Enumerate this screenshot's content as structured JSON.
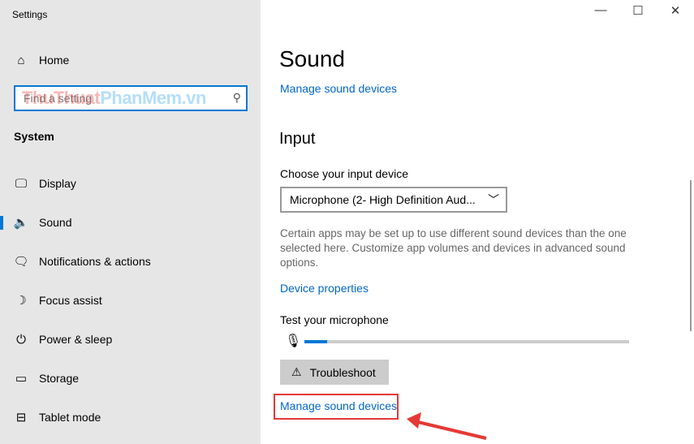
{
  "window": {
    "title": "Settings",
    "minimize": "—",
    "maximize": "☐",
    "close": "✕"
  },
  "sidebar": {
    "home": "Home",
    "search_placeholder": "Find a setting",
    "section": "System",
    "items": [
      {
        "label": "Display",
        "icon": "🖵"
      },
      {
        "label": "Sound",
        "icon": "🔈"
      },
      {
        "label": "Notifications & actions",
        "icon": "🗨"
      },
      {
        "label": "Focus assist",
        "icon": "☽"
      },
      {
        "label": "Power & sleep",
        "icon": "⏻"
      },
      {
        "label": "Storage",
        "icon": "▭"
      },
      {
        "label": "Tablet mode",
        "icon": "⊟"
      }
    ]
  },
  "watermark": {
    "part1": "ThuThuat",
    "part2": "PhanMem",
    "part3": ".vn"
  },
  "main": {
    "title": "Sound",
    "manage_top": "Manage sound devices",
    "input_heading": "Input",
    "choose_label": "Choose your input device",
    "device_value": "Microphone (2- High Definition Aud...",
    "description": "Certain apps may be set up to use different sound devices than the one selected here. Customize app volumes and devices in advanced sound options.",
    "device_properties": "Device properties",
    "test_label": "Test your microphone",
    "mic_level_percent": 7,
    "troubleshoot": "Troubleshoot",
    "manage_bottom": "Manage sound devices"
  },
  "colors": {
    "accent": "#0078d7",
    "highlight": "#e53935"
  }
}
